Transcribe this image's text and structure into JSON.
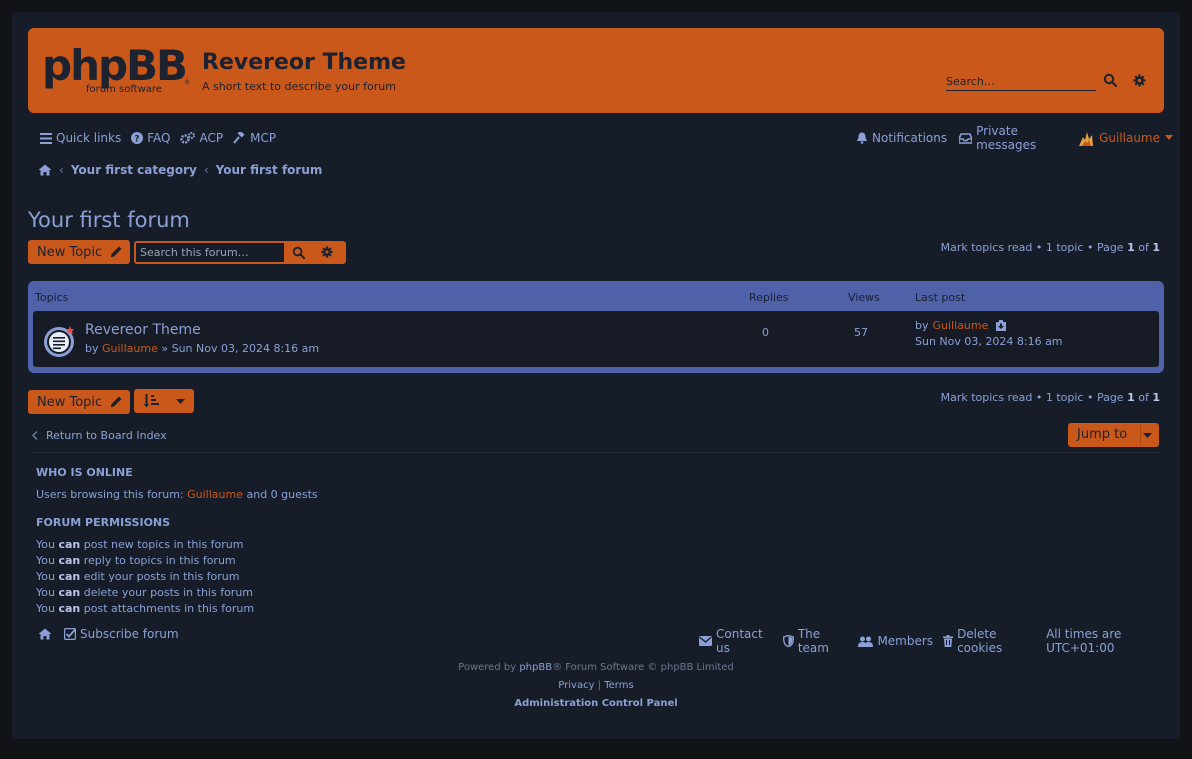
{
  "header": {
    "site_title": "Revereor Theme",
    "site_desc": "A short text to describe your forum",
    "search_placeholder": "Search…",
    "colors": {
      "accent": "#c9581a",
      "link": "#8aa0d6",
      "bg": "#171d28"
    }
  },
  "nav": {
    "quick_links": "Quick links",
    "faq": "FAQ",
    "acp": "ACP",
    "mcp": "MCP",
    "notifications": "Notifications",
    "private_messages": "Private messages",
    "username": "Guillaume"
  },
  "breadcrumb": {
    "home_icon": "home-icon",
    "separator": "‹",
    "category": "Your first category",
    "forum": "Your first forum"
  },
  "forum": {
    "title": "Your first forum",
    "new_topic": "New Topic",
    "search_placeholder": "Search this forum…",
    "pagination": {
      "mark_read": "Mark topics read",
      "topic_count": "1 topic",
      "page_label": "Page",
      "page": "1",
      "of": "of",
      "total": "1"
    }
  },
  "topics_table": {
    "headers": {
      "topics": "Topics",
      "replies": "Replies",
      "views": "Views",
      "last_post": "Last post"
    },
    "rows": [
      {
        "title": "Revereor Theme",
        "by": "by",
        "author": "Guillaume",
        "raquo": "»",
        "date": "Sun Nov 03, 2024 8:16 am",
        "replies": "0",
        "views": "57",
        "last_by": "by",
        "last_author": "Guillaume",
        "last_date": "Sun Nov 03, 2024 8:16 am"
      }
    ]
  },
  "bottom": {
    "return_label": "Return to Board Index",
    "jump_to": "Jump to"
  },
  "online": {
    "heading": "WHO IS ONLINE",
    "prefix": "Users browsing this forum:",
    "user": "Guillaume",
    "suffix": "and 0 guests"
  },
  "permissions": {
    "heading": "FORUM PERMISSIONS",
    "you": "You",
    "can": "can",
    "items": [
      "post new topics in this forum",
      "reply to topics in this forum",
      "edit your posts in this forum",
      "delete your posts in this forum",
      "post attachments in this forum"
    ]
  },
  "footer": {
    "subscribe": "Subscribe forum",
    "contact": "Contact us",
    "team": "The team",
    "members": "Members",
    "delete_cookies": "Delete cookies",
    "times": "All times are",
    "timezone": "UTC+01:00",
    "powered_by": "Powered by",
    "phpbb": "phpBB",
    "copyright": "® Forum Software © phpBB Limited",
    "privacy": "Privacy",
    "pipe": "|",
    "terms": "Terms",
    "acp": "Administration Control Panel"
  }
}
